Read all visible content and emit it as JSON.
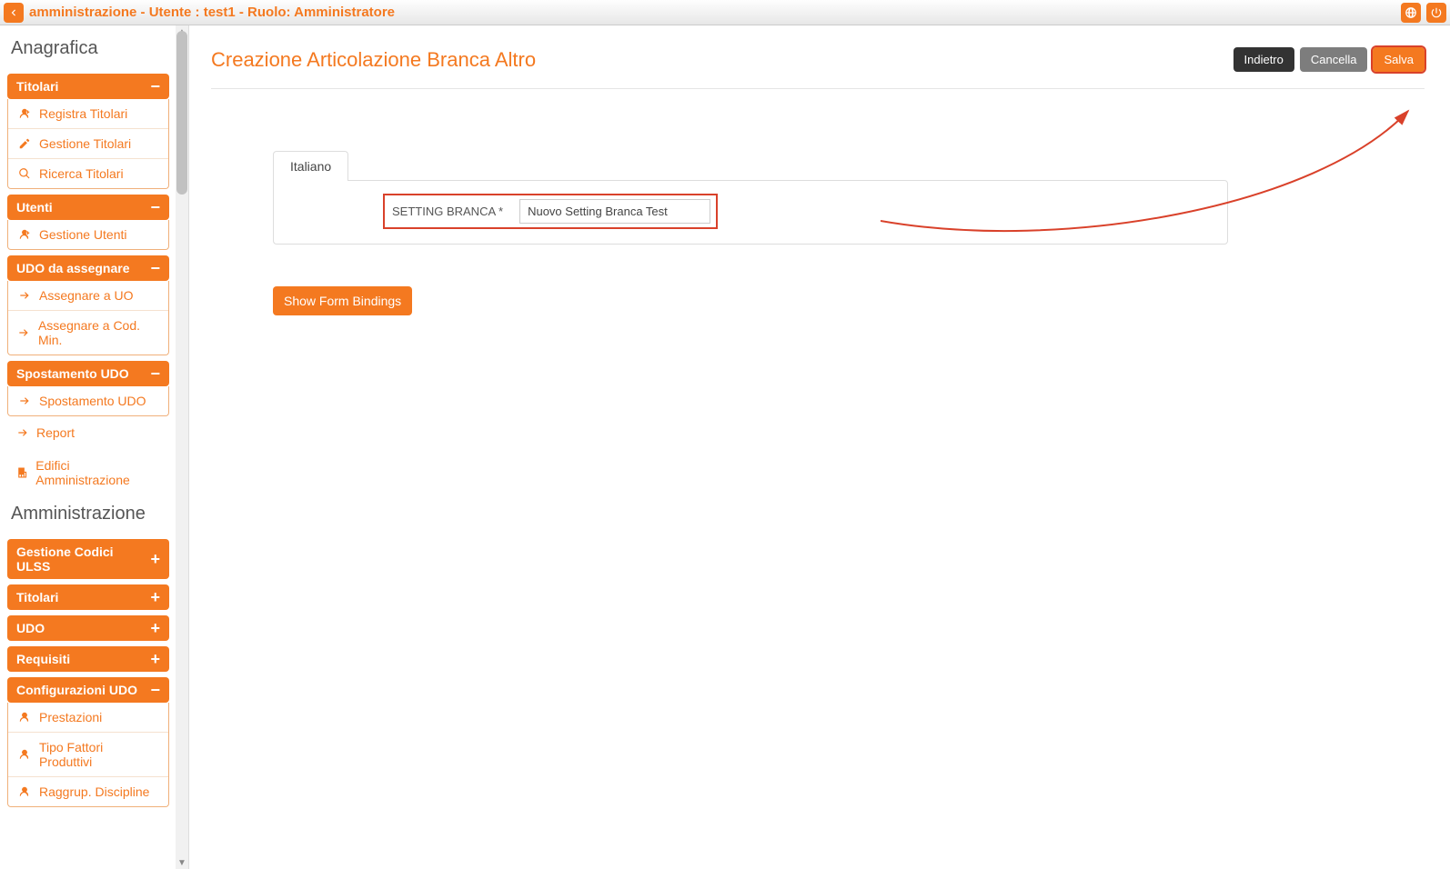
{
  "topbar": {
    "title": "amministrazione - Utente : test1 - Ruolo: Amministratore"
  },
  "sidebar": {
    "section1": "Anagrafica",
    "panels": {
      "titolari": {
        "label": "Titolari",
        "open": true,
        "items": [
          {
            "icon": "user-plus",
            "label": "Registra Titolari"
          },
          {
            "icon": "edit",
            "label": "Gestione Titolari"
          },
          {
            "icon": "search",
            "label": "Ricerca Titolari"
          }
        ]
      },
      "utenti": {
        "label": "Utenti",
        "open": true,
        "items": [
          {
            "icon": "user-plus",
            "label": "Gestione Utenti"
          }
        ]
      },
      "udo_assegnare": {
        "label": "UDO da assegnare",
        "open": true,
        "items": [
          {
            "icon": "arrow",
            "label": "Assegnare a UO"
          },
          {
            "icon": "arrow",
            "label": "Assegnare a Cod. Min."
          }
        ]
      },
      "spostamento": {
        "label": "Spostamento UDO",
        "open": true,
        "items": [
          {
            "icon": "arrow",
            "label": "Spostamento UDO"
          }
        ]
      }
    },
    "links": [
      {
        "icon": "arrow",
        "label": "Report"
      },
      {
        "icon": "building",
        "label": "Edifici Amministrazione"
      }
    ],
    "section2": "Amministrazione",
    "panels2": {
      "gestione_codici": {
        "label": "Gestione Codici ULSS",
        "open": false
      },
      "titolari2": {
        "label": "Titolari",
        "open": false
      },
      "udo": {
        "label": "UDO",
        "open": false
      },
      "requisiti": {
        "label": "Requisiti",
        "open": false
      },
      "config_udo": {
        "label": "Configurazioni UDO",
        "open": true,
        "items": [
          {
            "icon": "user-plus",
            "label": "Prestazioni"
          },
          {
            "icon": "user-plus",
            "label": "Tipo Fattori Produttivi"
          },
          {
            "icon": "user-plus",
            "label": "Raggrup. Discipline"
          }
        ]
      }
    }
  },
  "main": {
    "title": "Creazione Articolazione Branca Altro",
    "buttons": {
      "back": "Indietro",
      "cancel": "Cancella",
      "save": "Salva"
    },
    "tab": "Italiano",
    "field": {
      "label": "SETTING BRANCA *",
      "value": "Nuovo Setting Branca Test"
    },
    "show_bindings": "Show Form Bindings"
  }
}
